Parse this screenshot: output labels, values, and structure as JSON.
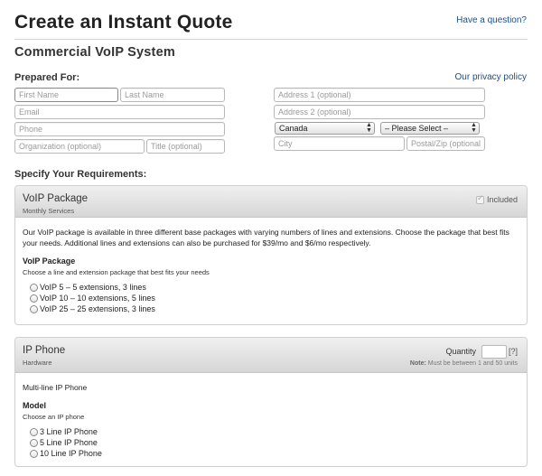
{
  "header": {
    "title": "Create an Instant Quote",
    "help_link": "Have a question?",
    "subtitle": "Commercial VoIP System"
  },
  "prepared_for": {
    "label": "Prepared For:",
    "privacy_link": "Our privacy policy",
    "first_name_placeholder": "First Name",
    "last_name_placeholder": "Last Name",
    "email_placeholder": "Email",
    "phone_placeholder": "Phone",
    "organization_placeholder": "Organization (optional)",
    "title_placeholder": "Title (optional)",
    "address1_placeholder": "Address 1 (optional)",
    "address2_placeholder": "Address 2 (optional)",
    "country_value": "Canada",
    "province_value": "– Please Select –",
    "city_placeholder": "City",
    "postal_placeholder": "Postal/Zip (optional)"
  },
  "requirements": {
    "label": "Specify Your Requirements:"
  },
  "voip_panel": {
    "title": "VoIP Package",
    "subtitle": "Monthly Services",
    "included_label": "Included",
    "description": "Our VoIP package is available in three different base packages with varying numbers of lines and extensions. Choose the package that best fits your needs. Additional lines and extensions can also be purchased for $39/mo and $6/mo respectively.",
    "group_title": "VoIP Package",
    "group_sub": "Choose a line and extension package that best fits your needs",
    "options": [
      "VoIP 5 – 5 extensions, 3 lines",
      "VoIP 10 – 10 extensions, 5 lines",
      "VoIP 25 – 25 extensions, 3 lines"
    ]
  },
  "ip_panel": {
    "title": "IP Phone",
    "subtitle": "Hardware",
    "quantity_label": "Quantity",
    "quantity_help": "[?]",
    "note_prefix": "Note:",
    "note_text": "Must be between 1 and 50 units",
    "description": "Multi-line IP Phone",
    "group_title": "Model",
    "group_sub": "Choose an IP phone",
    "options": [
      "3 Line IP Phone",
      "5 Line IP Phone",
      "10 Line IP Phone"
    ]
  }
}
